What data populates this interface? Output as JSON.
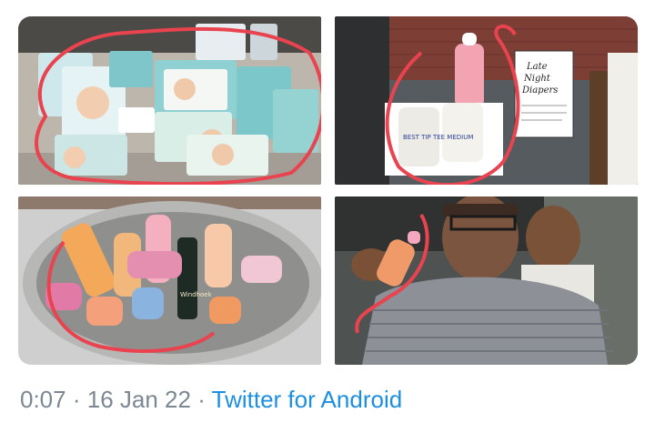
{
  "tweet": {
    "photos": [
      {
        "description": "diapers",
        "icon": "diaper-packs-photo"
      },
      {
        "description": "sign",
        "icon": "baby-bottle-diaper-sign-photo"
      },
      {
        "description": "bucket",
        "icon": "bottles-in-bucket-photo"
      },
      {
        "description": "man",
        "icon": "man-holding-bottle-photo"
      }
    ],
    "sign_lines": [
      "Late",
      "Night",
      "Diapers"
    ],
    "diaper_note": "BEST TIP TEE MEDIUM",
    "bottle_brand": "Windhoek",
    "time": "0:07",
    "separator": "·",
    "date": "16 Jan 22",
    "source": "Twitter for Android",
    "colors": {
      "meta_text": "#7b8894",
      "link": "#1d8fe0",
      "annotation": "#e8434f"
    }
  }
}
